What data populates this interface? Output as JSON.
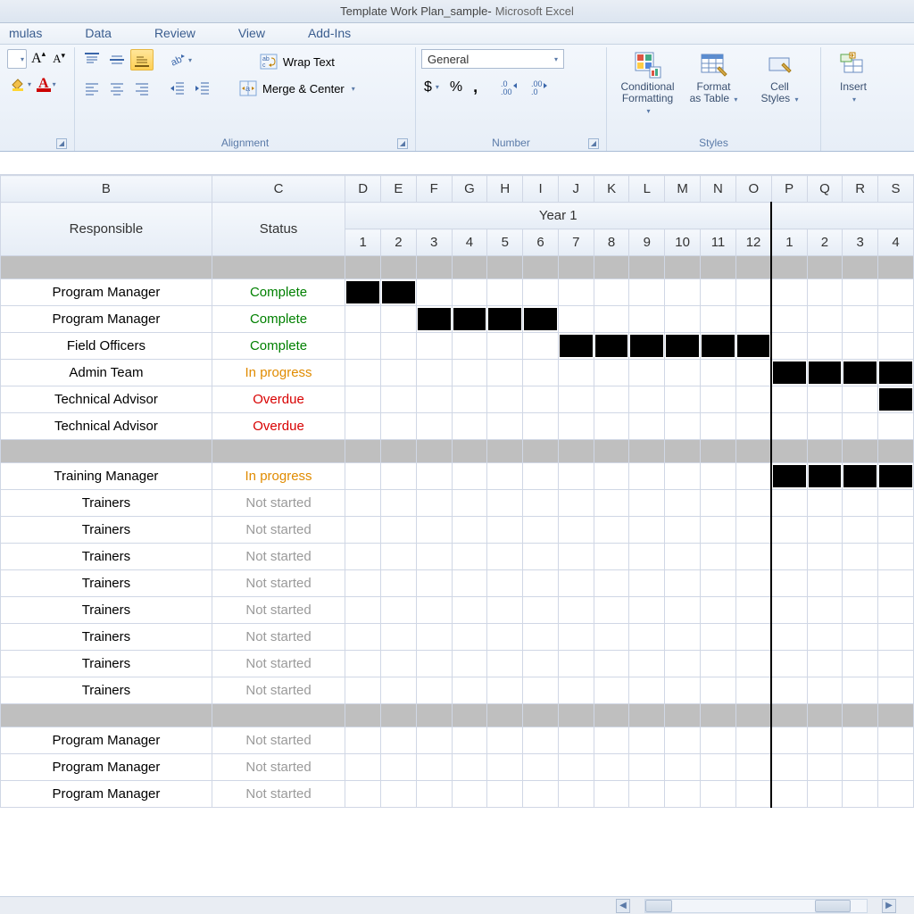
{
  "titlebar": {
    "document": "Template Work Plan_sample",
    "sep": " - ",
    "app": "Microsoft Excel"
  },
  "tabs": {
    "t0": "mulas",
    "t1": "Data",
    "t2": "Review",
    "t3": "View",
    "t4": "Add-Ins"
  },
  "ribbon": {
    "font": {
      "growA": "A",
      "shrinkA": "A"
    },
    "alignment": {
      "label": "Alignment",
      "wrap": "Wrap Text",
      "merge": "Merge & Center"
    },
    "number": {
      "label": "Number",
      "format": "General",
      "dollar": "$",
      "percent": "%",
      "comma": ","
    },
    "styles": {
      "label": "Styles",
      "cond1": "Conditional",
      "cond2": "Formatting",
      "fmt1": "Format",
      "fmt2": "as Table",
      "cell1": "Cell",
      "cell2": "Styles"
    },
    "cells": {
      "insert": "Insert"
    }
  },
  "sheet": {
    "colLetters": [
      "B",
      "C",
      "D",
      "E",
      "F",
      "G",
      "H",
      "I",
      "J",
      "K",
      "L",
      "M",
      "N",
      "O",
      "P",
      "Q",
      "R",
      "S"
    ],
    "hdrResponsible": "Responsible",
    "hdrStatus": "Status",
    "year1": "Year 1",
    "months": [
      "1",
      "2",
      "3",
      "4",
      "5",
      "6",
      "7",
      "8",
      "9",
      "10",
      "11",
      "12",
      "1",
      "2",
      "3",
      "4"
    ],
    "rows": [
      {
        "type": "gray"
      },
      {
        "type": "task",
        "responsible": "Program Manager",
        "status": "Complete",
        "statusClass": "st-complete",
        "bars": [
          0,
          1
        ]
      },
      {
        "type": "task",
        "responsible": "Program Manager",
        "status": "Complete",
        "statusClass": "st-complete",
        "bars": [
          2,
          3,
          4,
          5
        ]
      },
      {
        "type": "task",
        "responsible": "Field Officers",
        "status": "Complete",
        "statusClass": "st-complete",
        "bars": [
          6,
          7,
          8,
          9,
          10,
          11
        ]
      },
      {
        "type": "task",
        "responsible": "Admin Team",
        "status": "In progress",
        "statusClass": "st-inprogress",
        "bars": [
          12,
          13,
          14,
          15
        ]
      },
      {
        "type": "task",
        "responsible": "Technical Advisor",
        "status": "Overdue",
        "statusClass": "st-overdue",
        "bars": [
          15
        ]
      },
      {
        "type": "task",
        "responsible": "Technical Advisor",
        "status": "Overdue",
        "statusClass": "st-overdue",
        "bars": []
      },
      {
        "type": "gray"
      },
      {
        "type": "task",
        "responsible": "Training Manager",
        "status": "In progress",
        "statusClass": "st-inprogress",
        "bars": [
          12,
          13,
          14,
          15
        ]
      },
      {
        "type": "task",
        "responsible": "Trainers",
        "status": "Not started",
        "statusClass": "st-notstarted",
        "bars": []
      },
      {
        "type": "task",
        "responsible": "Trainers",
        "status": "Not started",
        "statusClass": "st-notstarted",
        "bars": []
      },
      {
        "type": "task",
        "responsible": "Trainers",
        "status": "Not started",
        "statusClass": "st-notstarted",
        "bars": []
      },
      {
        "type": "task",
        "responsible": "Trainers",
        "status": "Not started",
        "statusClass": "st-notstarted",
        "bars": []
      },
      {
        "type": "task",
        "responsible": "Trainers",
        "status": "Not started",
        "statusClass": "st-notstarted",
        "bars": []
      },
      {
        "type": "task",
        "responsible": "Trainers",
        "status": "Not started",
        "statusClass": "st-notstarted",
        "bars": []
      },
      {
        "type": "task",
        "responsible": "Trainers",
        "status": "Not started",
        "statusClass": "st-notstarted",
        "bars": []
      },
      {
        "type": "task",
        "responsible": "Trainers",
        "status": "Not started",
        "statusClass": "st-notstarted",
        "bars": []
      },
      {
        "type": "gray"
      },
      {
        "type": "task",
        "responsible": "Program Manager",
        "status": "Not started",
        "statusClass": "st-notstarted",
        "bars": []
      },
      {
        "type": "task",
        "responsible": "Program Manager",
        "status": "Not started",
        "statusClass": "st-notstarted",
        "bars": []
      },
      {
        "type": "task",
        "responsible": "Program Manager",
        "status": "Not started",
        "statusClass": "st-notstarted",
        "bars": []
      }
    ]
  }
}
